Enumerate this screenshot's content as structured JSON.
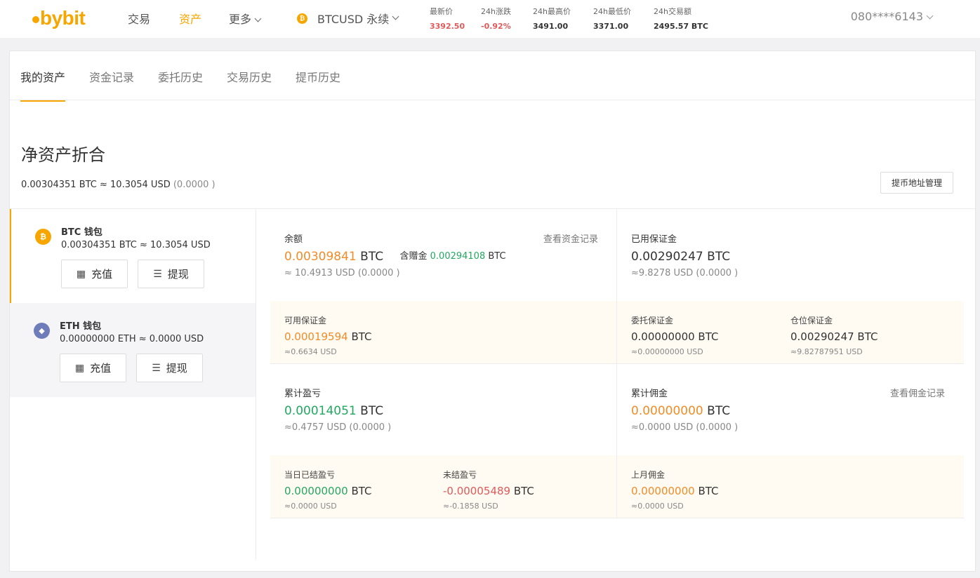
{
  "nav": {
    "logo_text": "bybit",
    "items": [
      "交易",
      "资产",
      "更多"
    ],
    "symbol": "BTCUSD 永续",
    "symbol_coin_glyph": "₿",
    "account": "080****6143"
  },
  "tickers": [
    {
      "label": "最新价",
      "value": "3392.50"
    },
    {
      "label": "24h涨跌",
      "value": "-0.92%"
    },
    {
      "label": "24h最高价",
      "value": "3491.00"
    },
    {
      "label": "24h最低价",
      "value": "3371.00"
    },
    {
      "label": "24h交易额",
      "value": "2495.57 BTC"
    }
  ],
  "tabs": [
    "我的资产",
    "资金记录",
    "委托历史",
    "交易历史",
    "提币历史"
  ],
  "net": {
    "title": "净资产折合",
    "value": "0.00304351 BTC ≈ 10.3054 USD",
    "change": "(0.0000 )",
    "addr_button": "提币地址管理"
  },
  "wallets": [
    {
      "name": "BTC 钱包",
      "glyph": "₿",
      "balance": "0.00304351 BTC ≈ 10.3054 USD",
      "deposit": "充值",
      "withdraw": "提现"
    },
    {
      "name": "ETH 钱包",
      "glyph": "◆",
      "balance": "0.00000000 ETH ≈ 0.0000 USD",
      "deposit": "充值",
      "withdraw": "提现"
    }
  ],
  "balance": {
    "label": "余额",
    "amount": "0.00309841",
    "unit": "BTC",
    "bonus_label": "含赠金",
    "bonus_amount": "0.00294108",
    "bonus_unit": "BTC",
    "usd": "≈ 10.4913 USD (0.0000 )",
    "link": "查看资金记录"
  },
  "used_margin": {
    "label": "已用保证金",
    "amount": "0.00290247 BTC",
    "usd": "≈9.8278 USD (0.0000 )"
  },
  "available_margin": {
    "label": "可用保证金",
    "amount": "0.00019594",
    "unit": "BTC",
    "usd": "≈0.6634 USD"
  },
  "order_margin": {
    "label": "委托保证金",
    "amount": "0.00000000 BTC",
    "usd": "≈0.00000000 USD"
  },
  "position_margin": {
    "label": "仓位保证金",
    "amount": "0.00290247 BTC",
    "usd": "≈9.82787951 USD"
  },
  "cum_pnl": {
    "label": "累计盈亏",
    "amount": "0.00014051",
    "unit": "BTC",
    "usd": "≈0.4757 USD (0.0000 )"
  },
  "cum_commission": {
    "label": "累计佣金",
    "amount": "0.00000000",
    "unit": "BTC",
    "usd": "≈0.0000 USD (0.0000 )",
    "link": "查看佣金记录"
  },
  "today_realized": {
    "label": "当日已结盈亏",
    "amount": "0.00000000",
    "unit": "BTC",
    "usd": "≈0.0000 USD"
  },
  "unrealized": {
    "label": "未结盈亏",
    "amount": "-0.00005489",
    "unit": "BTC",
    "usd": "≈-0.1858 USD"
  },
  "last_month_commission": {
    "label": "上月佣金",
    "amount": "0.00000000",
    "unit": "BTC",
    "usd": "≈0.0000 USD"
  },
  "colors": {
    "accent": "#f7a600",
    "positive": "#22a860",
    "negative": "#e15a5a",
    "highlight": "#f28c28"
  }
}
